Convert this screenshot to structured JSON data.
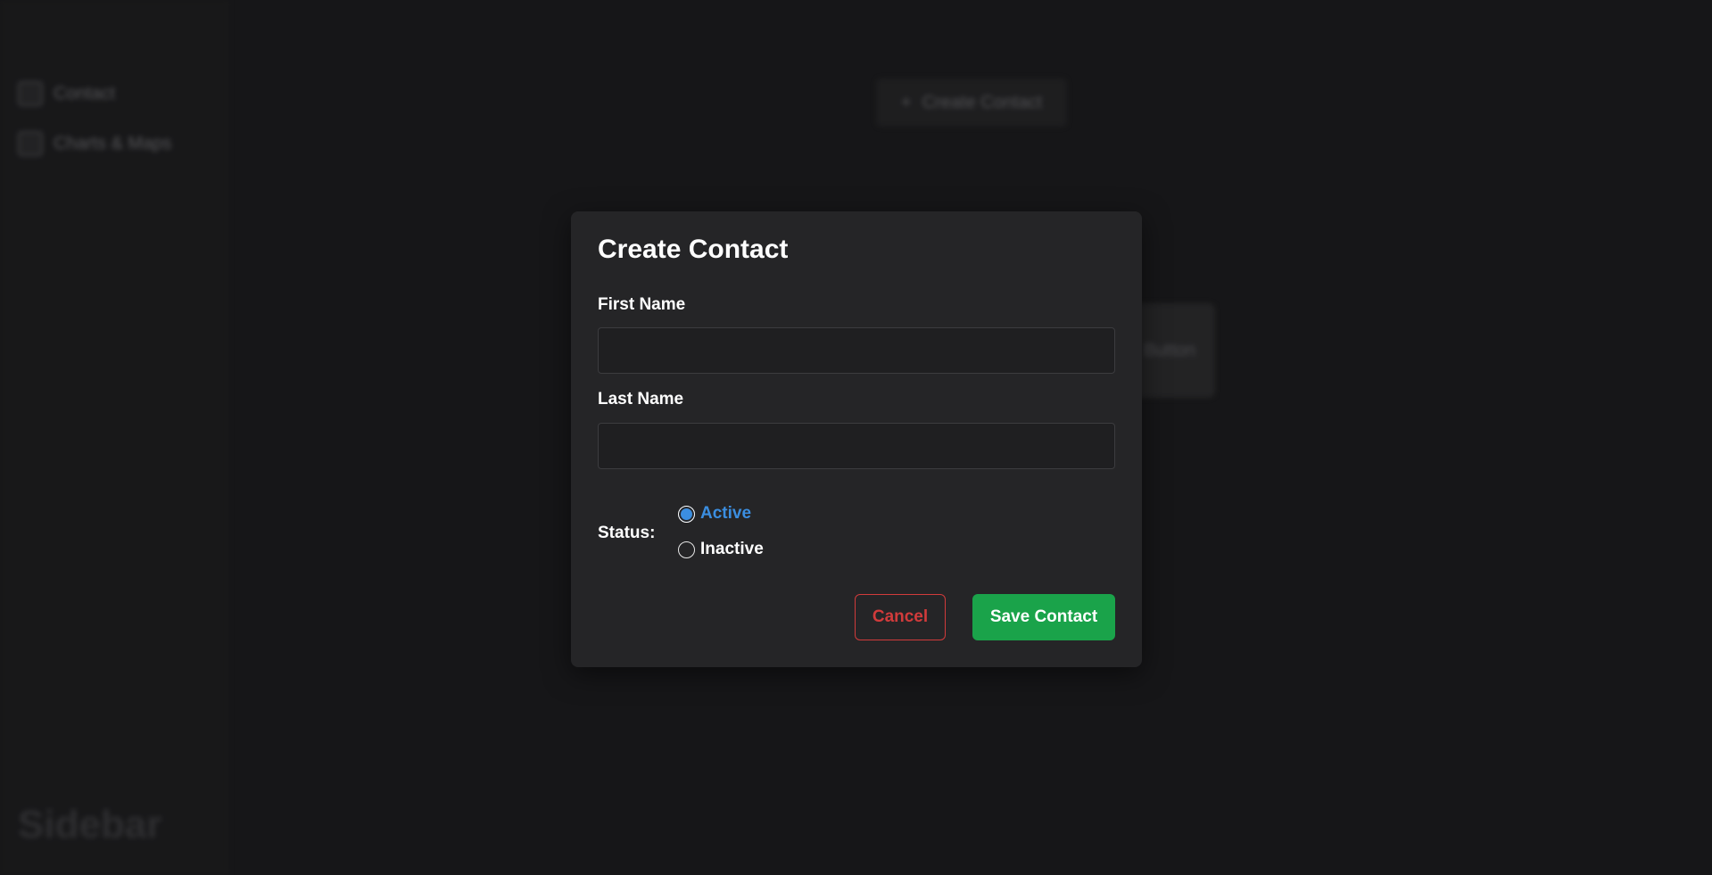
{
  "sidebar": {
    "items": [
      {
        "label": "Contact",
        "icon": "contact-icon"
      },
      {
        "label": "Charts & Maps",
        "icon": "chart-icon"
      }
    ],
    "brand": "Sidebar"
  },
  "background": {
    "create_button": {
      "icon": "plus-icon",
      "label": "Create Contact"
    },
    "card_label": "Button"
  },
  "modal": {
    "title": "Create Contact",
    "first_name": {
      "label": "First Name",
      "value": "",
      "placeholder": ""
    },
    "last_name": {
      "label": "Last Name",
      "value": "",
      "placeholder": ""
    },
    "status": {
      "label": "Status:",
      "options": [
        {
          "label": "Active",
          "selected": true
        },
        {
          "label": "Inactive",
          "selected": false
        }
      ]
    },
    "cancel_label": "Cancel",
    "save_label": "Save Contact"
  },
  "colors": {
    "background": "#1a1a1c",
    "modal": "#252527",
    "accent": "#3b8ee0",
    "danger": "#d13b3b",
    "success": "#1aa34a"
  }
}
